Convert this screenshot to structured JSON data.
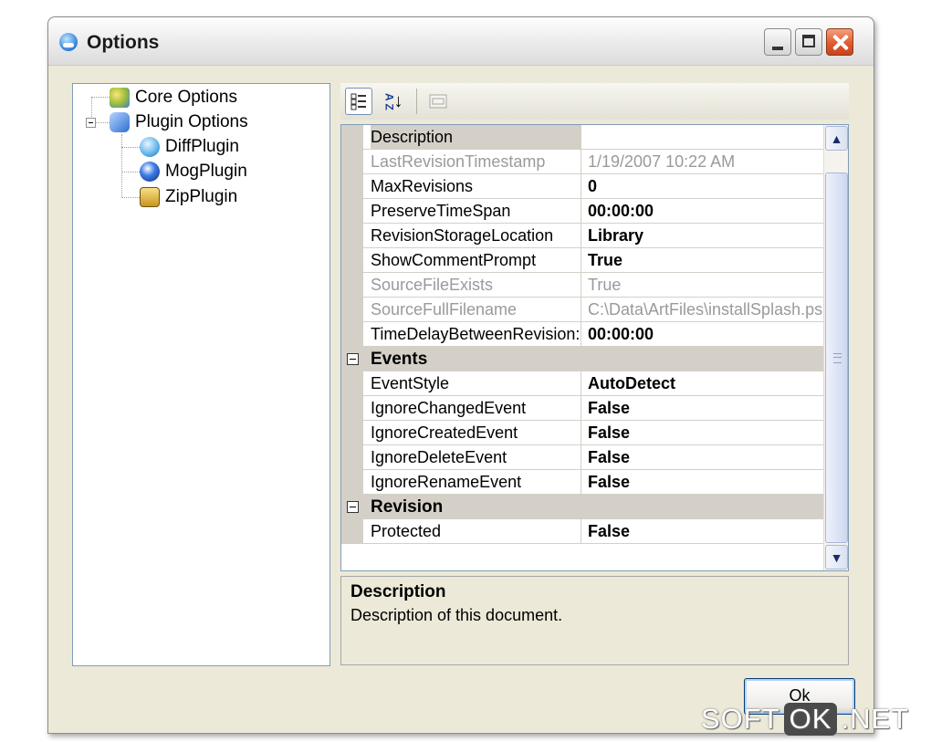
{
  "window": {
    "title": "Options"
  },
  "tree": {
    "items": [
      {
        "label": "Core Options",
        "icon": "gears-icon"
      },
      {
        "label": "Plugin Options",
        "icon": "plugin-icon"
      },
      {
        "label": "DiffPlugin",
        "icon": "diff-icon"
      },
      {
        "label": "MogPlugin",
        "icon": "mog-icon"
      },
      {
        "label": "ZipPlugin",
        "icon": "zip-icon"
      }
    ]
  },
  "toolbar": {
    "categorized_icon": "categorized-icon",
    "sort_label": "A Z",
    "property_pages_icon": "property-pages-icon"
  },
  "grid": {
    "rows": [
      {
        "name": "Description",
        "value": "",
        "dim": false
      },
      {
        "name": "LastRevisionTimestamp",
        "value": "1/19/2007 10:22 AM",
        "dim": true
      },
      {
        "name": "MaxRevisions",
        "value": "0",
        "dim": false
      },
      {
        "name": "PreserveTimeSpan",
        "value": "00:00:00",
        "dim": false
      },
      {
        "name": "RevisionStorageLocation",
        "value": "Library",
        "dim": false
      },
      {
        "name": "ShowCommentPrompt",
        "value": "True",
        "dim": false
      },
      {
        "name": "SourceFileExists",
        "value": "True",
        "dim": true
      },
      {
        "name": "SourceFullFilename",
        "value": "C:\\Data\\ArtFiles\\installSplash.ps",
        "dim": true
      },
      {
        "name": "TimeDelayBetweenRevision:",
        "value": "00:00:00",
        "dim": false
      }
    ],
    "categories": [
      {
        "label": "Events",
        "rows": [
          {
            "name": "EventStyle",
            "value": "AutoDetect"
          },
          {
            "name": "IgnoreChangedEvent",
            "value": "False"
          },
          {
            "name": "IgnoreCreatedEvent",
            "value": "False"
          },
          {
            "name": "IgnoreDeleteEvent",
            "value": "False"
          },
          {
            "name": "IgnoreRenameEvent",
            "value": "False"
          }
        ]
      },
      {
        "label": "Revision",
        "rows": [
          {
            "name": "Protected",
            "value": "False"
          }
        ]
      }
    ]
  },
  "description": {
    "title": "Description",
    "text": "Description of this document."
  },
  "buttons": {
    "ok": "Ok"
  },
  "watermark": {
    "left": "SOFT",
    "box": "OK",
    "right": ".NET"
  }
}
